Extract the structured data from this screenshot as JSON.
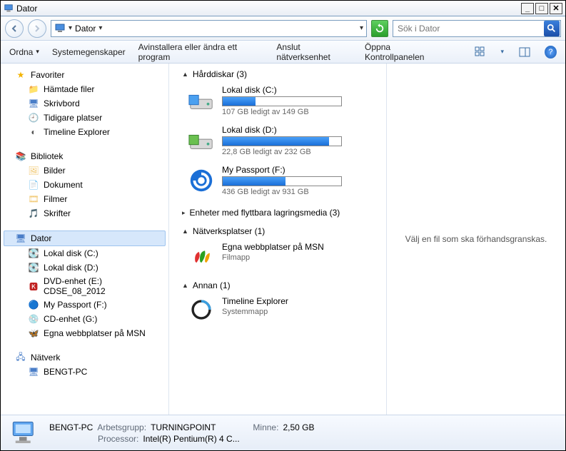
{
  "window": {
    "title": "Dator"
  },
  "breadcrumb": {
    "label": "Dator"
  },
  "search": {
    "placeholder": "Sök i Dator"
  },
  "toolbar": {
    "organize": "Ordna",
    "sysprops": "Systemegenskaper",
    "uninstall": "Avinstallera eller ändra ett program",
    "netdrive": "Anslut nätverksenhet",
    "cpanel": "Öppna Kontrollpanelen"
  },
  "nav": {
    "favorites": "Favoriter",
    "fav_items": [
      "Hämtade filer",
      "Skrivbord",
      "Tidigare platser",
      "Timeline Explorer"
    ],
    "libraries": "Bibliotek",
    "lib_items": [
      "Bilder",
      "Dokument",
      "Filmer",
      "Skrifter"
    ],
    "computer": "Dator",
    "comp_items": [
      "Lokal disk (C:)",
      "Lokal disk (D:)",
      "DVD-enhet (E:) CDSE_08_2012",
      "My Passport (F:)",
      "CD-enhet (G:)",
      "Egna webbplatser på MSN"
    ],
    "network": "Nätverk",
    "net_items": [
      "BENGT-PC"
    ]
  },
  "groups": {
    "hdd": {
      "title": "Hårddiskar (3)"
    },
    "removable": {
      "title": "Enheter med flyttbara lagringsmedia (3)"
    },
    "netloc": {
      "title": "Nätverksplatser (1)"
    },
    "other": {
      "title": "Annan (1)"
    }
  },
  "drives": [
    {
      "name": "Lokal disk (C:)",
      "sub": "107 GB ledigt av 149 GB",
      "used_pct": 28
    },
    {
      "name": "Lokal disk (D:)",
      "sub": "22,8 GB ledigt av 232 GB",
      "used_pct": 90
    },
    {
      "name": "My Passport (F:)",
      "sub": "436 GB ledigt av 931 GB",
      "used_pct": 53
    }
  ],
  "netloc_item": {
    "name": "Egna webbplatser på MSN",
    "kind": "Filmapp"
  },
  "other_item": {
    "name": "Timeline Explorer",
    "kind": "Systemmapp"
  },
  "preview": {
    "empty": "Välj en fil som ska förhandsgranskas."
  },
  "status": {
    "pc": "BENGT-PC",
    "wg_lbl": "Arbetsgrupp:",
    "wg": "TURNINGPOINT",
    "mem_lbl": "Minne:",
    "mem": "2,50 GB",
    "cpu_lbl": "Processor:",
    "cpu": "Intel(R) Pentium(R) 4 C..."
  }
}
